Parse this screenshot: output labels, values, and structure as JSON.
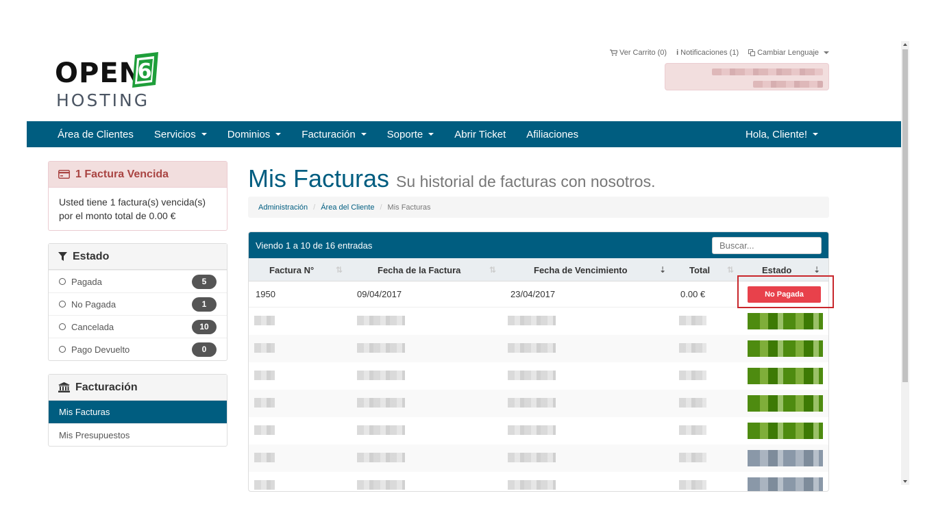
{
  "brand": {
    "logo_top": "OPEN",
    "logo_digit": "6",
    "logo_bottom": "HOSTING",
    "green": "#1e9e3a"
  },
  "colors": {
    "primary": "#005d80",
    "danger": "#e8414b",
    "highlight": "#c8262b"
  },
  "top_links": {
    "cart": "Ver Carrito (0)",
    "notifications": "Notificaciones (1)",
    "language": "Cambiar Lenguaje"
  },
  "nav": {
    "items": [
      {
        "label": "Área de Clientes"
      },
      {
        "label": "Servicios"
      },
      {
        "label": "Dominios"
      },
      {
        "label": "Facturación"
      },
      {
        "label": "Soporte"
      },
      {
        "label": "Abrir Ticket"
      },
      {
        "label": "Afiliaciones"
      }
    ],
    "user": "Hola, Cliente!"
  },
  "sidebar": {
    "overdue": {
      "title": "1 Factura Vencida",
      "body": "Usted tiene 1 factura(s) vencida(s) por el monto total de 0.00 €"
    },
    "estado": {
      "title": "Estado",
      "items": [
        {
          "label": "Pagada",
          "count": "5"
        },
        {
          "label": "No Pagada",
          "count": "1"
        },
        {
          "label": "Cancelada",
          "count": "10"
        },
        {
          "label": "Pago Devuelto",
          "count": "0"
        }
      ]
    },
    "facturacion": {
      "title": "Facturación",
      "items": [
        {
          "label": "Mis Facturas",
          "active": true
        },
        {
          "label": "Mis Presupuestos",
          "active": false
        }
      ]
    }
  },
  "page": {
    "title": "Mis Facturas",
    "subtitle": "Su historial de facturas con nosotros.",
    "breadcrumb": [
      "Administración",
      "Área del Cliente",
      "Mis Facturas"
    ]
  },
  "table": {
    "info": "Viendo 1 a 10 de 16 entradas",
    "search_placeholder": "Buscar...",
    "columns": [
      "Factura N°",
      "Fecha de la Factura",
      "Fecha de Vencimiento",
      "Total",
      "Estado"
    ],
    "rows": [
      {
        "number": "1950",
        "date": "09/04/2017",
        "due": "23/04/2017",
        "total": "0.00 €",
        "status": "No Pagada"
      }
    ]
  }
}
